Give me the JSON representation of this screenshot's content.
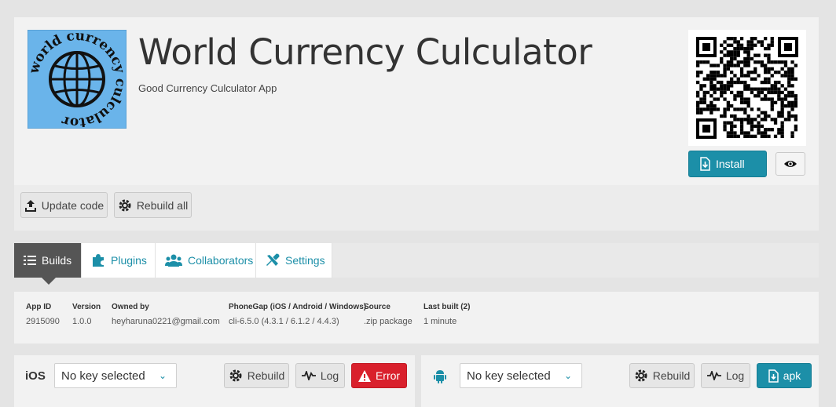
{
  "app": {
    "title": "World Currency Culculator",
    "description": "Good Currency Culculator App",
    "icon_text": "world currency culculator"
  },
  "header": {
    "install_label": "Install",
    "preview_icon": "eye-icon"
  },
  "actions": {
    "update_code_label": "Update code",
    "rebuild_all_label": "Rebuild all"
  },
  "tabs": [
    {
      "label": "Builds",
      "icon": "list-icon",
      "active": true
    },
    {
      "label": "Plugins",
      "icon": "puzzle-icon",
      "active": false
    },
    {
      "label": "Collaborators",
      "icon": "users-icon",
      "active": false
    },
    {
      "label": "Settings",
      "icon": "wrench-icon",
      "active": false
    }
  ],
  "info": {
    "app_id": {
      "label": "App ID",
      "value": "2915090"
    },
    "version": {
      "label": "Version",
      "value": "1.0.0"
    },
    "owned_by": {
      "label": "Owned by",
      "value": "heyharuna0221@gmail.com"
    },
    "phonegap": {
      "label": "PhoneGap (iOS / Android / Windows)",
      "value": "cli-6.5.0 (4.3.1 / 6.1.2 / 4.4.3)"
    },
    "source": {
      "label": "Source",
      "value": ".zip package"
    },
    "last_built": {
      "label": "Last built (2)",
      "value": "1 minute"
    }
  },
  "ios": {
    "platform_label": "iOS",
    "key_select": "No key selected",
    "rebuild_label": "Rebuild",
    "log_label": "Log",
    "status_label": "Error"
  },
  "android": {
    "key_select": "No key selected",
    "rebuild_label": "Rebuild",
    "log_label": "Log",
    "status_label": "apk"
  },
  "colors": {
    "accent": "#1c8fa8",
    "error": "#d9202c",
    "active_tab": "#555555"
  }
}
